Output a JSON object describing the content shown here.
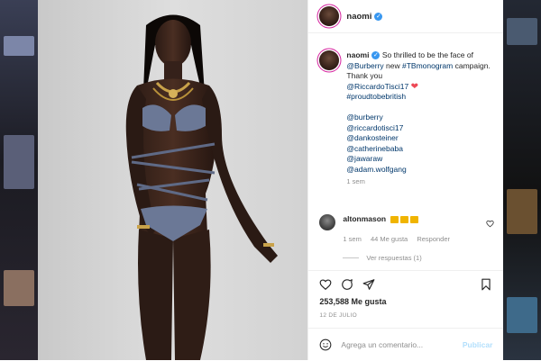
{
  "post": {
    "username": "naomi",
    "caption": {
      "username": "naomi",
      "text_1": "So thrilled to be the face of",
      "mention_burberry": "@Burberry",
      "text_2": "new",
      "hashtag_1": "#TBmonogram",
      "text_3": "campaign. Thank you",
      "mention_riccardo": "@RiccardoTisci17",
      "hashtag_2": "#proudtobebritish",
      "tags": [
        "@burberry",
        "@riccardotisci17",
        "@dankosteiner",
        "@catherinebaba",
        "@jawaraw",
        "@adam.wolfgang"
      ],
      "age": "1 sem"
    },
    "comment": {
      "username": "altonmason",
      "age": "1 sem",
      "likes": "44 Me gusta",
      "reply": "Responder",
      "view_replies": "Ver respuestas (1)"
    },
    "likes": "253,588 Me gusta",
    "date": "12 DE JULIO",
    "add_comment_placeholder": "Agrega un comentario...",
    "post_button": "Publicar"
  },
  "colors": {
    "verified": "#3897f0",
    "heart": "#ed4956",
    "link": "#00376b",
    "post_disabled": "#b2dffc"
  },
  "icons": [
    "verified-badge-icon",
    "heart-icon",
    "comment-icon",
    "share-icon",
    "bookmark-icon",
    "emoji-icon",
    "like-comment-icon",
    "crown-emoji-icon"
  ]
}
